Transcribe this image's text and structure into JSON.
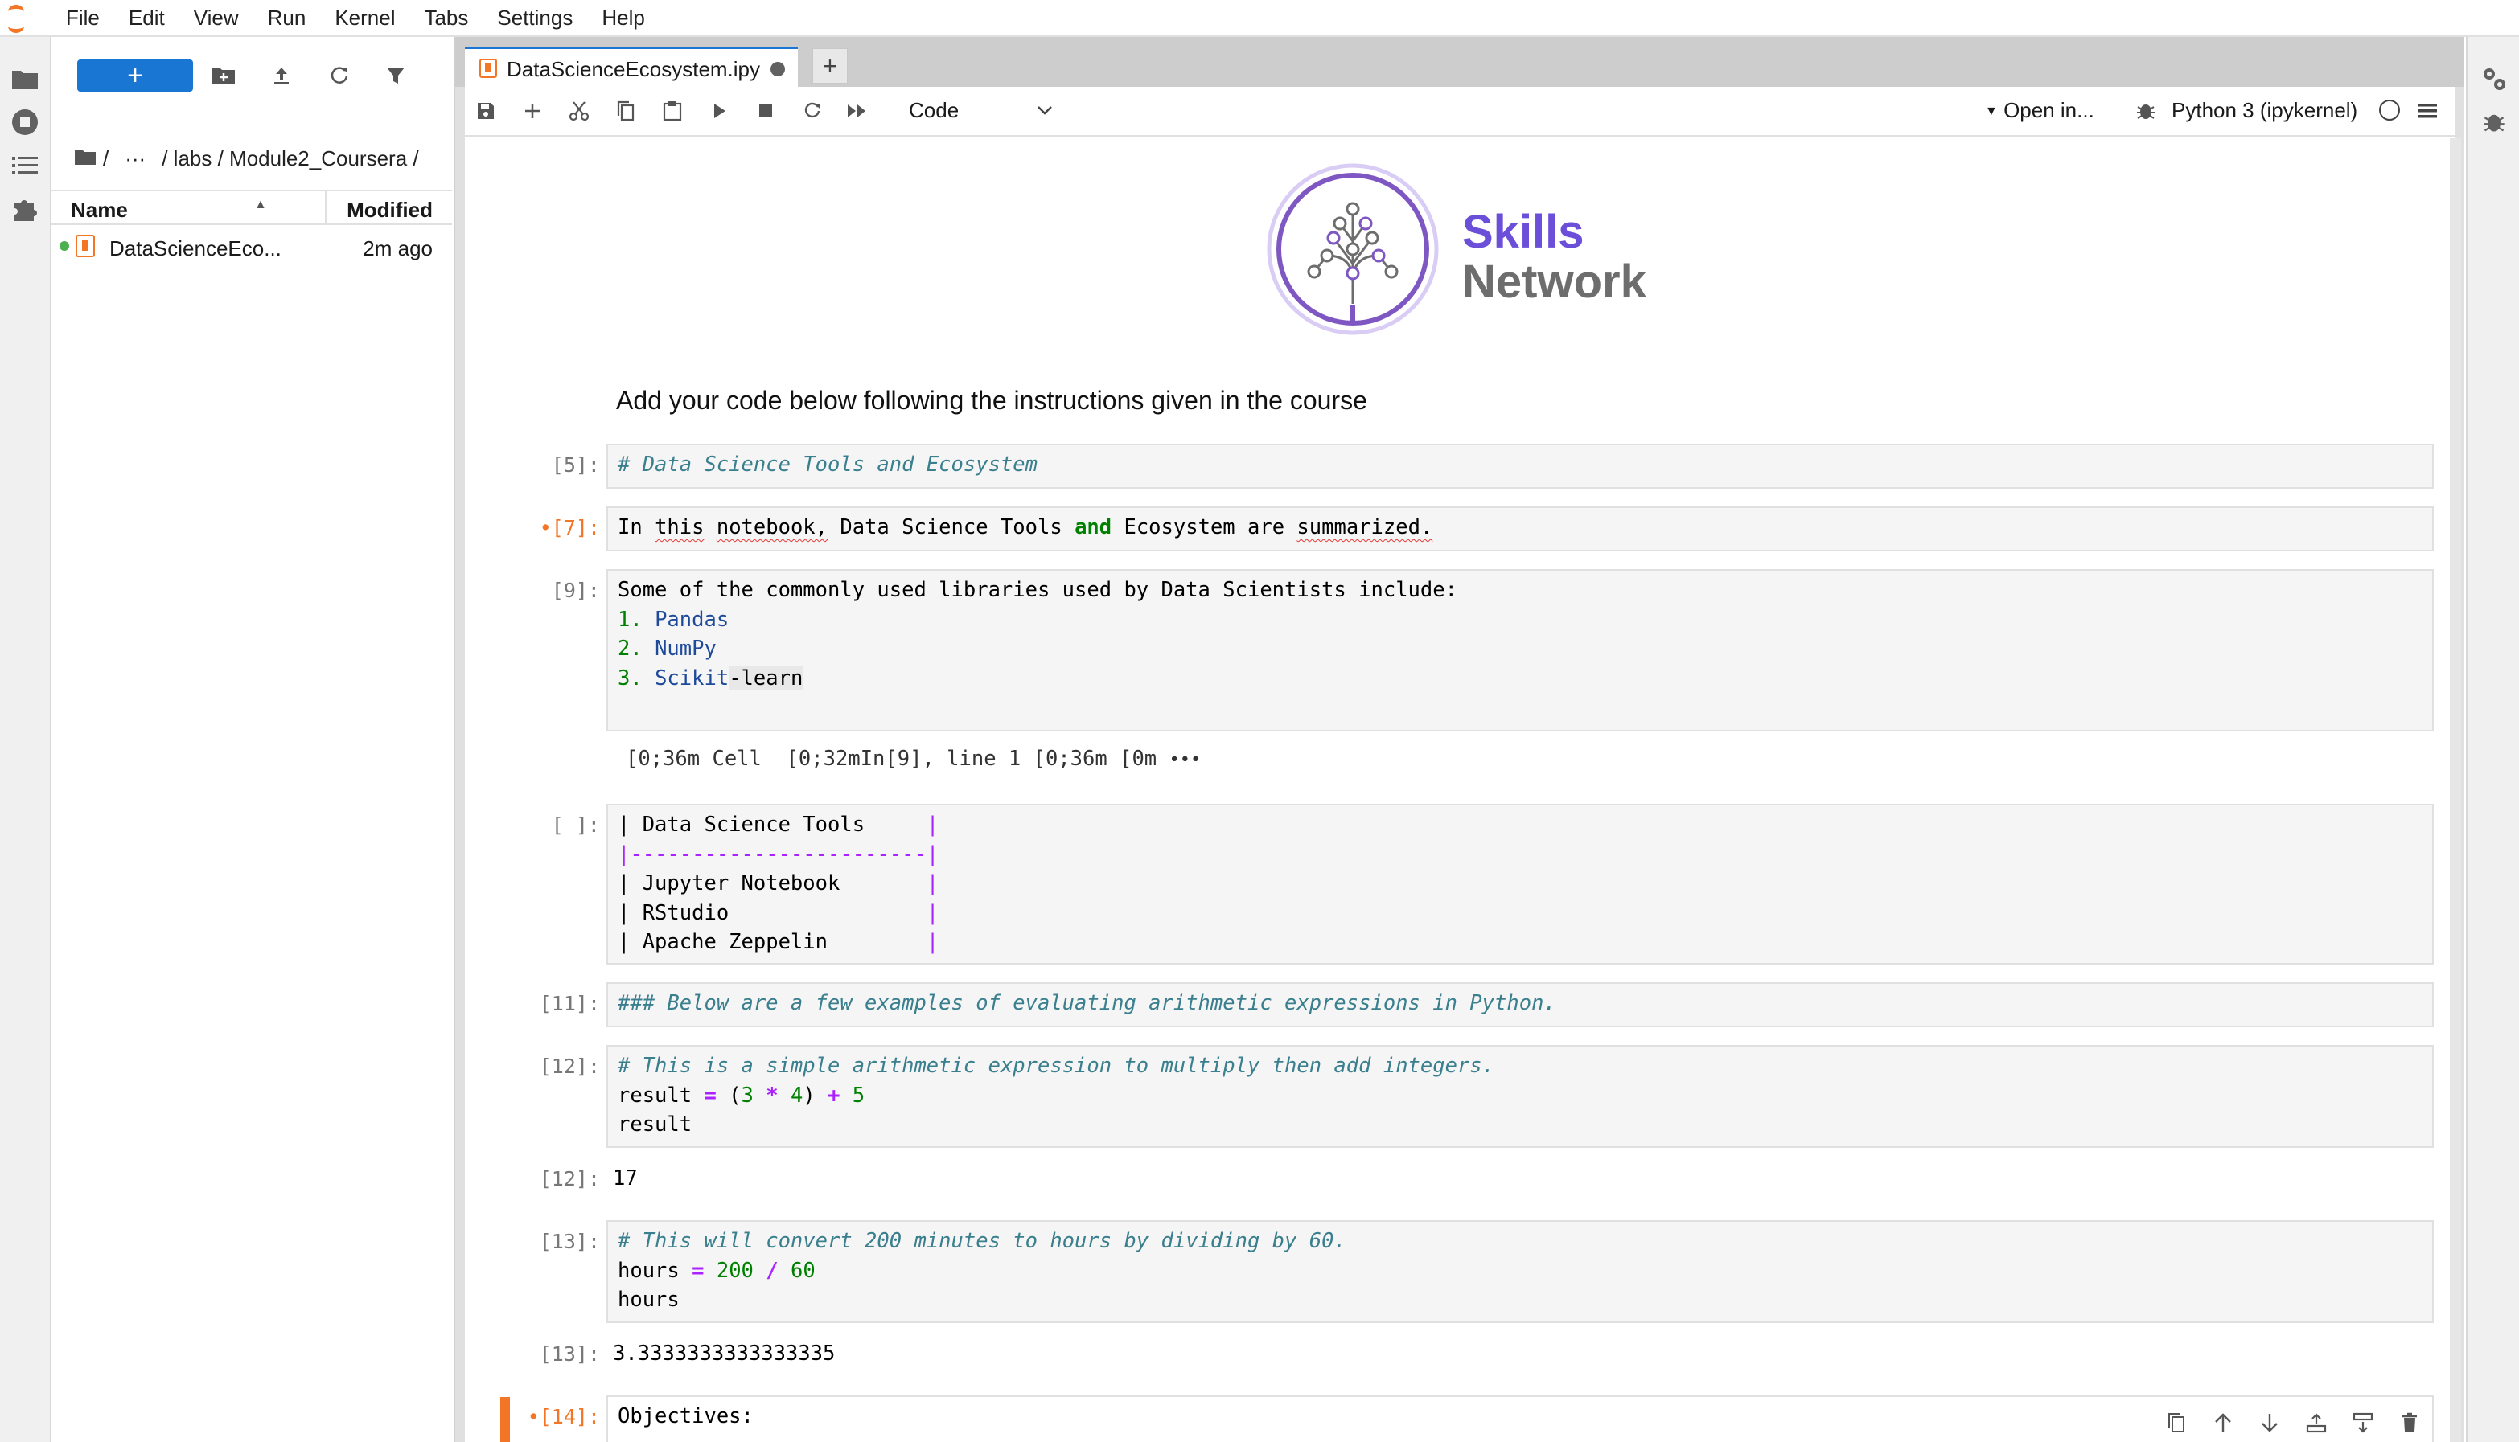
{
  "menubar": {
    "items": [
      "File",
      "Edit",
      "View",
      "Run",
      "Kernel",
      "Tabs",
      "Settings",
      "Help"
    ]
  },
  "filebrowser": {
    "new_label": "+",
    "breadcrumb": {
      "root": "/",
      "ellipsis": "···",
      "path": "/ labs / Module2_Coursera /"
    },
    "columns": {
      "name": "Name",
      "modified": "Modified"
    },
    "files": [
      {
        "name": "DataScienceEco...",
        "modified": "2m ago"
      }
    ]
  },
  "tabs": {
    "active": {
      "title": "DataScienceEcosystem.ipy"
    },
    "add_label": "+"
  },
  "toolbar": {
    "cell_type": "Code",
    "open_in": "Open in...",
    "kernel": "Python 3 (ipykernel)"
  },
  "logo": {
    "line1": "Skills",
    "line2": "Network"
  },
  "heading": "Add your code below following the instructions given in the course",
  "cells": {
    "c5": {
      "prompt": "[5]:",
      "text": "# Data Science Tools and Ecosystem"
    },
    "c7": {
      "prompt": "•[7]:",
      "t1": "In ",
      "t2": "this",
      " t3": "",
      "w_this": "this",
      "w_notebook": "notebook,",
      "a": "In ",
      "b": " ",
      "c": " Data Science Tools ",
      "kw": "and",
      "d": " Ecosystem are ",
      "w_summ": "summarized."
    },
    "c9": {
      "prompt": "[9]:",
      "line1": "Some of the commonly used libraries used by Data Scientists include:",
      "items": [
        {
          "num": "1.",
          "text": "Pandas"
        },
        {
          "num": "2.",
          "text": "NumPy"
        },
        {
          "num": "3.",
          "text": "Scikit",
          "rest": "-learn"
        }
      ]
    },
    "err": {
      "text": "[0;36m Cell  [0;32mIn[9], line 1 [0;36m [0m",
      "more": "•••"
    },
    "cblank": {
      "prompt": "[ ]:",
      "lines": [
        "| Data Science Tools     ",
        "|------------------------",
        "| Jupyter Notebook       ",
        "| RStudio                ",
        "| Apache Zeppelin        "
      ],
      "pipe": "|"
    },
    "c11": {
      "prompt": "[11]:",
      "text": "### Below are a few examples of evaluating arithmetic expressions in Python."
    },
    "c12": {
      "prompt": "[12]:",
      "comment": "# This is a simple arithmetic expression to multiply then add integers.",
      "l2a": "result ",
      "eq": "=",
      "l2b": " (",
      "n3": "3",
      "mul": "*",
      "n4": "4",
      "l2c": ") ",
      "plus": "+",
      "n5": "5",
      "l3": "result",
      "out_prompt": "[12]:",
      "out": "17"
    },
    "c13": {
      "prompt": "[13]:",
      "comment": "# This will convert 200 minutes to hours by dividing by 60.",
      "l2a": "hours ",
      "eq": "=",
      "n200": "200",
      "div": "/",
      "n60": "60",
      "l3": "hours",
      "out_prompt": "[13]:",
      "out": "3.3333333333333335"
    },
    "c14": {
      "prompt": "•[14]:",
      "text": "Objectives:"
    }
  }
}
